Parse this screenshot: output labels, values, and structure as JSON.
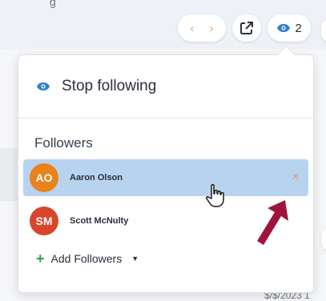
{
  "background": {
    "top_text": "g",
    "bottom_text": "$/$/2023 1"
  },
  "toolbar": {
    "prev_icon": "chevron-left-icon",
    "next_icon": "chevron-right-icon",
    "prev_glyph": "‹",
    "next_glyph": "›",
    "open_icon": "external-link-icon",
    "follow_icon": "eye-icon",
    "follower_count": "2"
  },
  "dropdown": {
    "stop_label": "Stop following",
    "followers_title": "Followers",
    "followers": [
      {
        "initials": "AO",
        "name": "Aaron Olson",
        "color": "#e8821a",
        "highlighted": true,
        "remove": "×"
      },
      {
        "initials": "SM",
        "name": "Scott McNulty",
        "color": "#d9452b",
        "highlighted": false
      }
    ],
    "add_label": "Add Followers",
    "add_plus": "+",
    "add_caret": "▼"
  },
  "colors": {
    "accent_blue": "#2f7fd6",
    "highlight": "#b7d3f0",
    "arrow": "#a0143c"
  }
}
